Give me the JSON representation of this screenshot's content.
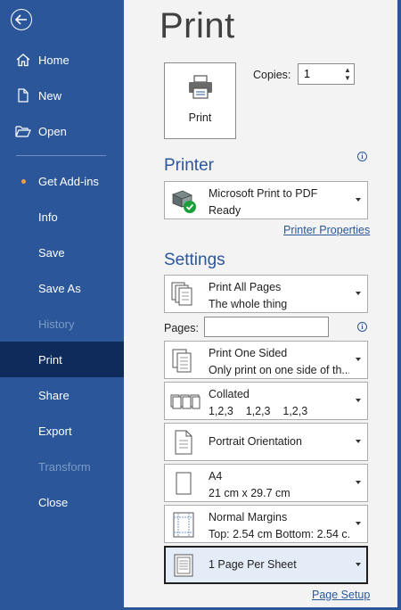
{
  "nav": {
    "items": [
      {
        "label": "Home",
        "icon": "home-icon"
      },
      {
        "label": "New",
        "icon": "new-document-icon"
      },
      {
        "label": "Open",
        "icon": "open-folder-icon"
      },
      {
        "label": "Get Add-ins",
        "icon": "notification-dot"
      },
      {
        "label": "Info"
      },
      {
        "label": "Save"
      },
      {
        "label": "Save As"
      },
      {
        "label": "History",
        "disabled": true
      },
      {
        "label": "Print",
        "selected": true
      },
      {
        "label": "Share"
      },
      {
        "label": "Export"
      },
      {
        "label": "Transform",
        "disabled": true
      },
      {
        "label": "Close"
      }
    ]
  },
  "page": {
    "title": "Print"
  },
  "print_button": {
    "label": "Print"
  },
  "copies": {
    "label": "Copies:",
    "value": "1"
  },
  "printer": {
    "section_title": "Printer",
    "name": "Microsoft Print to PDF",
    "status": "Ready",
    "properties_link": "Printer Properties"
  },
  "settings": {
    "section_title": "Settings",
    "print_range": {
      "title": "Print All Pages",
      "subtitle": "The whole thing"
    },
    "pages_label": "Pages:",
    "pages_value": "",
    "sides": {
      "title": "Print One Sided",
      "subtitle": "Only print on one side of th..."
    },
    "collation": {
      "title": "Collated",
      "subtitle": "1,2,3    1,2,3    1,2,3"
    },
    "orientation": {
      "title": "Portrait Orientation"
    },
    "paper": {
      "title": "A4",
      "subtitle": "21 cm x 29.7 cm"
    },
    "margins": {
      "title": "Normal Margins",
      "subtitle": "Top: 2.54 cm Bottom: 2.54 c..."
    },
    "per_sheet": {
      "title": "1 Page Per Sheet"
    },
    "page_setup_link": "Page Setup"
  },
  "colors": {
    "nav_bg": "#2b579a",
    "nav_selected": "#0e2b5b",
    "accent": "#2b579a",
    "status_ok": "#1a9e3a"
  }
}
